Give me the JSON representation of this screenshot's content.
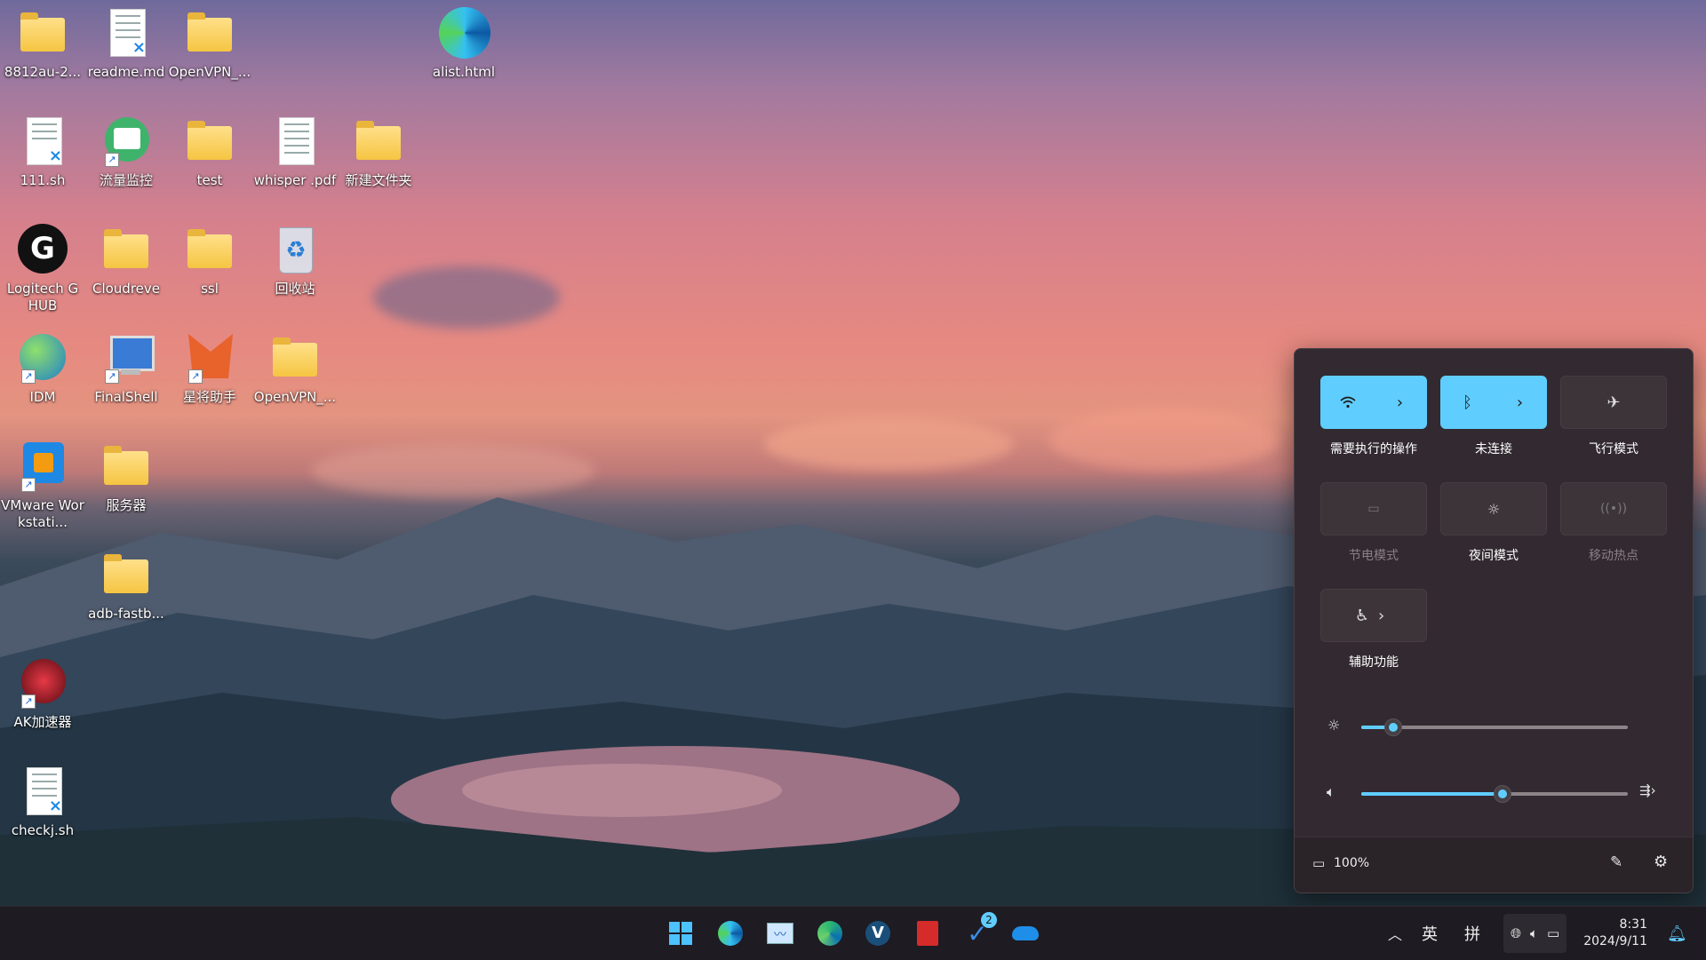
{
  "desktop": {
    "icons": [
      {
        "label": "8812au-2...",
        "type": "folder"
      },
      {
        "label": "readme.md",
        "type": "doc"
      },
      {
        "label": "OpenVPN_...",
        "type": "folder"
      },
      {
        "label": "alist.html",
        "type": "edge"
      },
      {
        "label": "111.sh",
        "type": "doc"
      },
      {
        "label": "流量监控",
        "type": "app"
      },
      {
        "label": "test",
        "type": "folder"
      },
      {
        "label": "whisper .pdf",
        "type": "doc"
      },
      {
        "label": "新建文件夹",
        "type": "folder"
      },
      {
        "label": "Logitech G HUB",
        "type": "app"
      },
      {
        "label": "Cloudreve",
        "type": "folder"
      },
      {
        "label": "ssl",
        "type": "folder"
      },
      {
        "label": "回收站",
        "type": "recycle"
      },
      {
        "label": "IDM",
        "type": "app"
      },
      {
        "label": "FinalShell",
        "type": "app"
      },
      {
        "label": "星将助手",
        "type": "app"
      },
      {
        "label": "OpenVPN_...",
        "type": "folder"
      },
      {
        "label": "VMware Workstati...",
        "type": "app"
      },
      {
        "label": "服务器",
        "type": "folder"
      },
      {
        "label": "adb-fastb...",
        "type": "folder"
      },
      {
        "label": "AK加速器",
        "type": "app"
      },
      {
        "label": "checkj.sh",
        "type": "doc"
      }
    ]
  },
  "quick_settings": {
    "tiles": [
      {
        "label": "需要执行的操作",
        "icon": "wifi-icon",
        "state": "on"
      },
      {
        "label": "未连接",
        "icon": "bluetooth-icon",
        "state": "on"
      },
      {
        "label": "飞行模式",
        "icon": "airplane-icon",
        "state": "off"
      },
      {
        "label": "节电模式",
        "icon": "battery-saver-icon",
        "state": "disabled"
      },
      {
        "label": "夜间模式",
        "icon": "night-light-icon",
        "state": "off"
      },
      {
        "label": "移动热点",
        "icon": "hotspot-icon",
        "state": "disabled"
      },
      {
        "label": "辅助功能",
        "icon": "accessibility-icon",
        "state": "off"
      }
    ],
    "brightness": 0.12,
    "volume": 0.53,
    "battery_text": "100%"
  },
  "taskbar": {
    "pinned": [
      "start-icon",
      "edge-icon",
      "task-manager-icon",
      "edge-beta-icon",
      "v-app-icon",
      "red-app-icon",
      "todo-icon",
      "onedrive-icon"
    ],
    "todo_badge": "2",
    "ime_lang": "英",
    "ime_mode": "拼",
    "time": "8:31",
    "date": "2024/9/11"
  },
  "colors": {
    "accent": "#60cdff"
  }
}
